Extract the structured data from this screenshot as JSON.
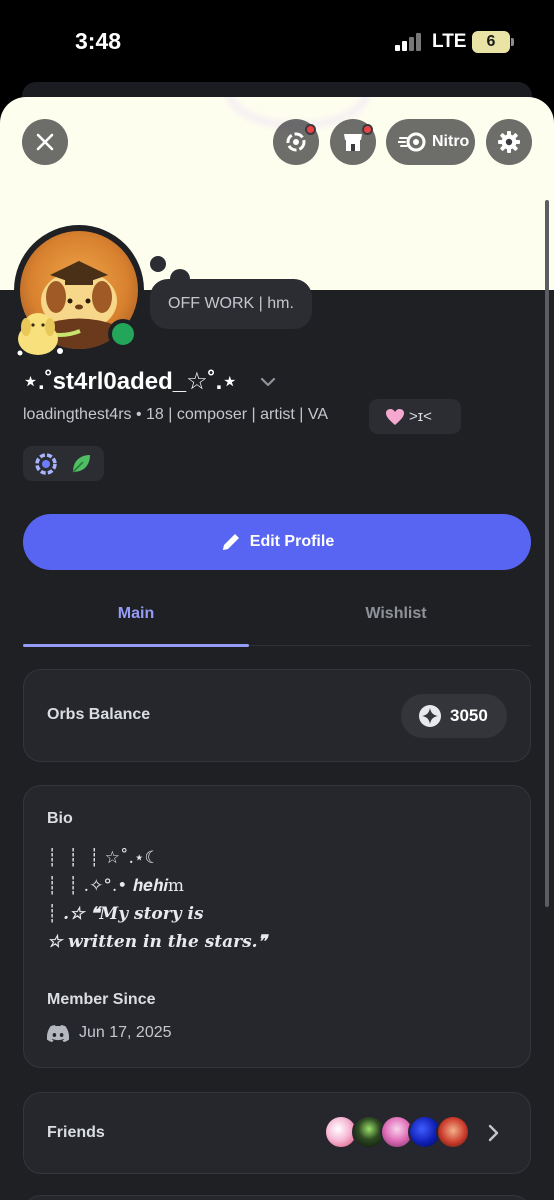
{
  "status_bar": {
    "time": "3:48",
    "network": "LTE",
    "battery": "6"
  },
  "header": {
    "close_icon": "close-icon",
    "quests_icon": "quest-icon",
    "shop_icon": "shop-icon",
    "nitro_label": "Nitro",
    "settings_icon": "gear-icon"
  },
  "profile": {
    "custom_status": "OFF WORK | hm.",
    "display_name": "⋆.˚st4rl0aded_☆˚.⋆",
    "tagline": "loadingthest4rs • 18 | composer | artist | VA",
    "pronouns": ">ɪ<",
    "edit_button_label": "Edit Profile"
  },
  "tabs": [
    {
      "label": "Main",
      "active": true
    },
    {
      "label": "Wishlist",
      "active": false
    }
  ],
  "orbs": {
    "title": "Orbs Balance",
    "value": "3050"
  },
  "bio": {
    "title": "Bio",
    "lines": [
      "┊  ┊  ┊ ☆˚.⋆☾",
      "┊  ┊ .✧°.• 𝒉𝒆𝒉𝒊m",
      "┊ .☆ ❝𝑴𝒚 𝒔𝒕𝒐𝒓𝒚 𝒊𝒔",
      "☆ 𝒘𝒓𝒊𝒕𝒕𝒆𝒏 𝒊𝒏 𝒕𝒉𝒆 𝒔𝒕𝒂𝒓𝒔.❞"
    ],
    "member_since_title": "Member Since",
    "member_since_date": "Jun 17, 2025"
  },
  "friends": {
    "title": "Friends"
  },
  "colors": {
    "accent": "#5865f2",
    "tab_active": "#949cf7",
    "online": "#23a55a",
    "notification": "#ed4245",
    "banner": "#fefeef"
  }
}
